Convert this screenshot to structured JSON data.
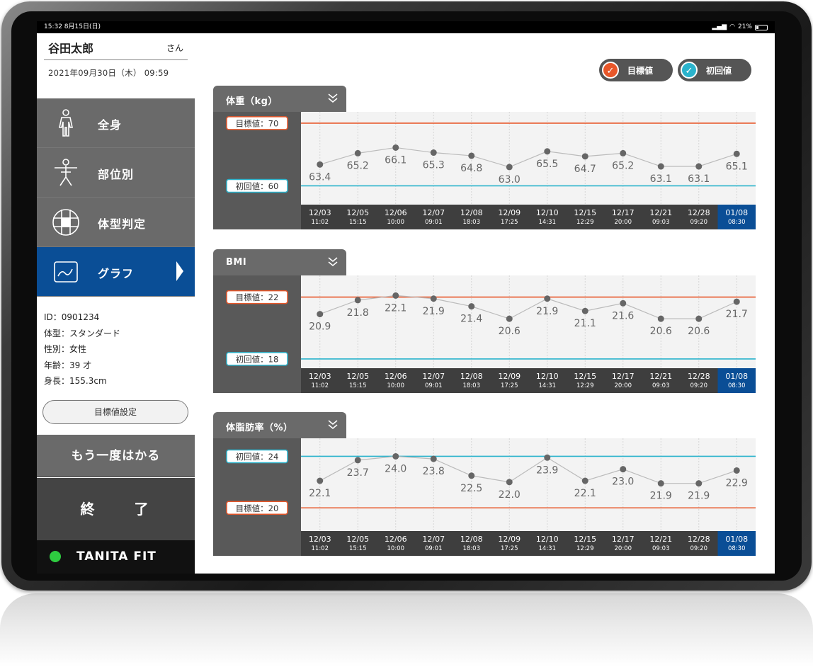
{
  "status": {
    "time": "15:32  8月15日(日)",
    "battery": "21%"
  },
  "user": {
    "name": "谷田太郎",
    "honorific": "さん",
    "datetime": "2021年09月30日（木） 09:59"
  },
  "nav": [
    {
      "label": "全身",
      "icon": "whole-body-icon"
    },
    {
      "label": "部位別",
      "icon": "body-part-icon"
    },
    {
      "label": "体型判定",
      "icon": "body-type-icon"
    },
    {
      "label": "グラフ",
      "icon": "graph-icon"
    }
  ],
  "profile": {
    "id": "ID：0901234",
    "body_type": "体型：スタンダード",
    "sex": "性別：女性",
    "age": "年齢：39 才",
    "height": "身長：155.3cm"
  },
  "buttons": {
    "target_setting": "目標値設定",
    "measure_again": "もう一度はかる",
    "end": "終　了"
  },
  "brand": "TANITA FIT",
  "legend": {
    "target": "目標値",
    "initial": "初回値"
  },
  "colors": {
    "target": "#e8572a",
    "initial": "#2bb3cc",
    "active": "#0a4e96",
    "dark": "#595959"
  },
  "chart_data": [
    {
      "type": "line",
      "title": "体重（kg）",
      "x": [
        {
          "date": "12/03",
          "time": "11:02"
        },
        {
          "date": "12/05",
          "time": "15:15"
        },
        {
          "date": "12/06",
          "time": "10:00"
        },
        {
          "date": "12/07",
          "time": "09:01"
        },
        {
          "date": "12/08",
          "time": "18:03"
        },
        {
          "date": "12/09",
          "time": "17:25"
        },
        {
          "date": "12/10",
          "time": "14:31"
        },
        {
          "date": "12/15",
          "time": "12:29"
        },
        {
          "date": "12/17",
          "time": "20:00"
        },
        {
          "date": "12/21",
          "time": "09:03"
        },
        {
          "date": "12/28",
          "time": "09:20"
        },
        {
          "date": "01/08",
          "time": "08:30"
        }
      ],
      "values": [
        63.4,
        65.2,
        66.1,
        65.3,
        64.8,
        63.0,
        65.5,
        64.7,
        65.2,
        63.1,
        63.1,
        65.1
      ],
      "labels": [
        "63.4",
        "65.2",
        "66.1",
        "65.3",
        "64.8",
        "63.0",
        "65.5",
        "64.7",
        "65.2",
        "63.1",
        "63.1",
        "65.1"
      ],
      "label_pos": [
        "below",
        "below",
        "below",
        "below",
        "below",
        "below",
        "below",
        "below",
        "below",
        "below",
        "below",
        "below"
      ],
      "target": {
        "label": "目標値：70",
        "value": 70
      },
      "initial": {
        "label": "初回値：60",
        "value": 60
      },
      "ylim": [
        57,
        71.8
      ],
      "ref_order": [
        "target",
        "initial"
      ],
      "highlight_index": 11
    },
    {
      "type": "line",
      "title": "BMI",
      "x": [
        {
          "date": "12/03",
          "time": "11:02"
        },
        {
          "date": "12/05",
          "time": "15:15"
        },
        {
          "date": "12/06",
          "time": "10:00"
        },
        {
          "date": "12/07",
          "time": "09:01"
        },
        {
          "date": "12/08",
          "time": "18:03"
        },
        {
          "date": "12/09",
          "time": "17:25"
        },
        {
          "date": "12/10",
          "time": "14:31"
        },
        {
          "date": "12/15",
          "time": "12:29"
        },
        {
          "date": "12/17",
          "time": "20:00"
        },
        {
          "date": "12/21",
          "time": "09:03"
        },
        {
          "date": "12/28",
          "time": "09:20"
        },
        {
          "date": "01/08",
          "time": "08:30"
        }
      ],
      "values": [
        20.9,
        21.8,
        22.1,
        21.9,
        21.4,
        20.6,
        21.9,
        21.1,
        21.6,
        20.6,
        20.6,
        21.7
      ],
      "labels": [
        "20.9",
        "21.8",
        "22.1",
        "21.9",
        "21.4",
        "20.6",
        "21.9",
        "21.1",
        "21.6",
        "20.6",
        "20.6",
        "21.7"
      ],
      "label_pos": [
        "below",
        "below",
        "below",
        "below",
        "below",
        "below",
        "below",
        "below",
        "below",
        "below",
        "below",
        "below"
      ],
      "target": {
        "label": "目標値：22",
        "value": 22
      },
      "initial": {
        "label": "初回値：18",
        "value": 18
      },
      "ylim": [
        17.4,
        23.4
      ],
      "ref_order": [
        "target",
        "initial"
      ],
      "highlight_index": 11
    },
    {
      "type": "line",
      "title": "体脂肪率（%）",
      "x": [
        {
          "date": "12/03",
          "time": "11:02"
        },
        {
          "date": "12/05",
          "time": "15:15"
        },
        {
          "date": "12/06",
          "time": "10:00"
        },
        {
          "date": "12/07",
          "time": "09:01"
        },
        {
          "date": "12/08",
          "time": "18:03"
        },
        {
          "date": "12/09",
          "time": "17:25"
        },
        {
          "date": "12/10",
          "time": "14:31"
        },
        {
          "date": "12/15",
          "time": "12:29"
        },
        {
          "date": "12/17",
          "time": "20:00"
        },
        {
          "date": "12/21",
          "time": "09:03"
        },
        {
          "date": "12/28",
          "time": "09:20"
        },
        {
          "date": "01/08",
          "time": "08:30"
        }
      ],
      "values": [
        22.1,
        23.7,
        24.0,
        23.8,
        22.5,
        22.0,
        23.9,
        22.1,
        23.0,
        21.9,
        21.9,
        22.9
      ],
      "labels": [
        "22.1",
        "23.7",
        "24.0",
        "23.8",
        "22.5",
        "22.0",
        "23.9",
        "22.1",
        "23.0",
        "21.9",
        "21.9",
        "22.9"
      ],
      "label_pos": [
        "below",
        "below",
        "below",
        "below",
        "below",
        "below",
        "below",
        "below",
        "below",
        "below",
        "below",
        "below"
      ],
      "target": {
        "label": "目標値：20",
        "value": 20
      },
      "initial": {
        "label": "初回値：24",
        "value": 24
      },
      "ylim": [
        18.2,
        25.4
      ],
      "ref_order": [
        "initial",
        "target"
      ],
      "highlight_index": 11
    }
  ]
}
